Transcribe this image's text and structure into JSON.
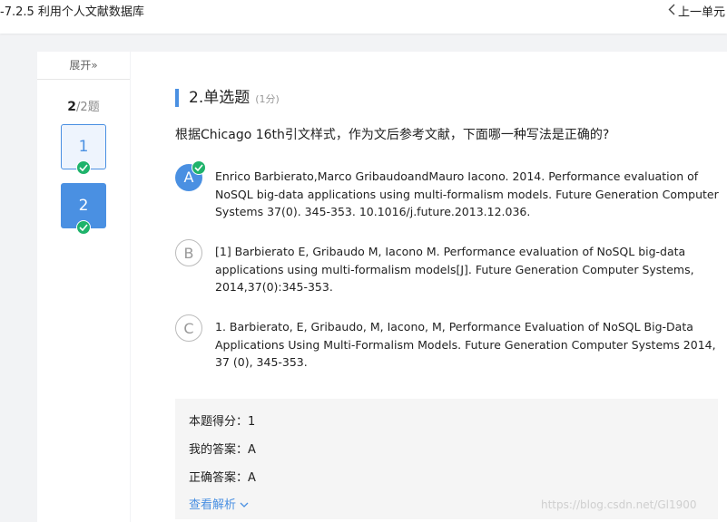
{
  "header": {
    "title": "-7.2.5 利用个人文献数据库",
    "prev_unit_label": "上一单元"
  },
  "sidebar": {
    "expand_label": "展开»",
    "current": "2",
    "total": "/2题",
    "questions": [
      {
        "number": "1",
        "answered": true
      },
      {
        "number": "2",
        "answered": true,
        "current": true
      }
    ]
  },
  "question": {
    "title": "2.单选题",
    "score": "(1分)",
    "stem": "根据Chicago 16th引文样式，作为文后参考文献，下面哪一种写法是正确的?",
    "options": [
      {
        "letter": "A",
        "selected": true,
        "text": "Enrico Barbierato,Marco GribaudoandMauro Iacono. 2014. Performance evaluation of NoSQL big-data applications using multi-formalism models. Future Generation Computer Systems 37(0). 345-353. 10.1016/j.future.2013.12.036."
      },
      {
        "letter": "B",
        "selected": false,
        "text": "[1] Barbierato E, Gribaudo M, Iacono M. Performance evaluation of NoSQL big-data applications using multi-formalism models[J]. Future Generation Computer Systems, 2014,37(0):345-353."
      },
      {
        "letter": "C",
        "selected": false,
        "text": "1. Barbierato, E, Gribaudo, M, Iacono, M, Performance Evaluation of NoSQL Big-Data Applications Using Multi-Formalism Models. Future Generation Computer Systems 2014, 37 (0), 345-353."
      }
    ]
  },
  "result": {
    "score_label": "本题得分：1",
    "my_answer_label": "我的答案：A",
    "correct_answer_label": "正确答案：A",
    "analysis_label": "查看解析"
  },
  "watermark": "https://blog.csdn.net/Gl1900",
  "colors": {
    "accent": "#4a90e2",
    "check": "#1fb36b",
    "background": "#f2f3f5"
  }
}
